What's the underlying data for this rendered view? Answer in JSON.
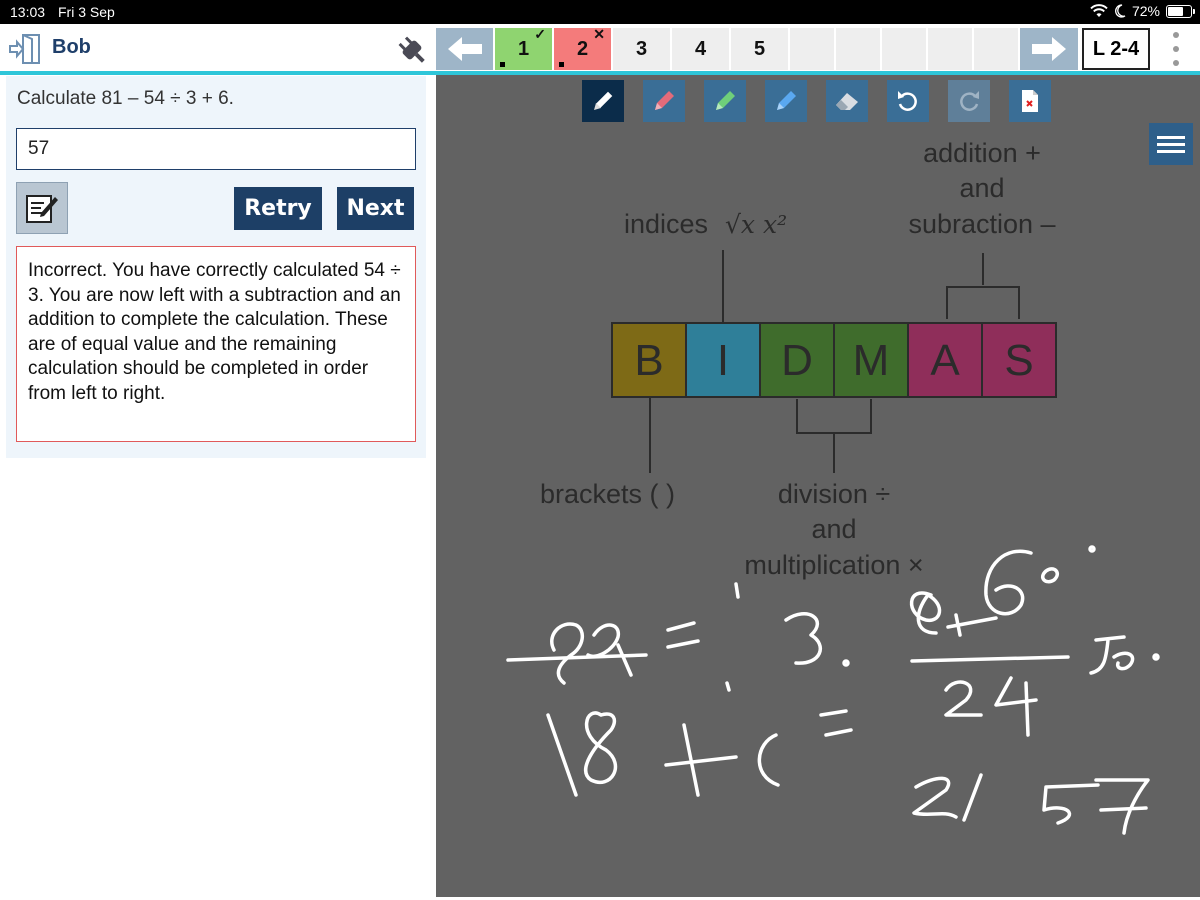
{
  "status_bar": {
    "time": "13:03",
    "date": "Fri 3 Sep",
    "battery": "72%",
    "battery_level": 0.72
  },
  "header": {
    "user_name": "Bob",
    "questions": [
      {
        "label": "1",
        "state": "correct",
        "mark": "✓"
      },
      {
        "label": "2",
        "state": "incorrect",
        "mark": "✕"
      },
      {
        "label": "3",
        "state": "pending"
      },
      {
        "label": "4",
        "state": "pending"
      },
      {
        "label": "5",
        "state": "pending"
      }
    ],
    "level": "L 2-4"
  },
  "question": {
    "text": "Calculate 81 – 54 ÷ 3 + 6.",
    "answer": "57"
  },
  "buttons": {
    "retry": "Retry",
    "next": "Next"
  },
  "feedback": "Incorrect. You have correctly calculated 54 ÷ 3. You are now left with a subtraction and an addition to complete the calculation. These are of equal value and the remaining calculation should be completed in order from left to right.",
  "toolbar": {
    "tools": [
      "pencil-white",
      "pencil-red",
      "pencil-green",
      "pencil-blue",
      "eraser",
      "undo",
      "redo",
      "clear-page"
    ]
  },
  "diagram": {
    "letters": [
      "B",
      "I",
      "D",
      "M",
      "A",
      "S"
    ],
    "colors": [
      "#7e6a16",
      "#2f7f99",
      "#3f6c2c",
      "#3f6c2c",
      "#8f2e5a",
      "#8f2e5a"
    ],
    "labels": {
      "indices": "indices",
      "indices_math": "√x x²",
      "addition_line1": "addition +",
      "addition_line2": "and",
      "addition_line3": "subraction –",
      "brackets": "brackets (   )",
      "division_line1": "division ÷",
      "division_line2": "and",
      "division_line3": "multiplication ×"
    }
  }
}
